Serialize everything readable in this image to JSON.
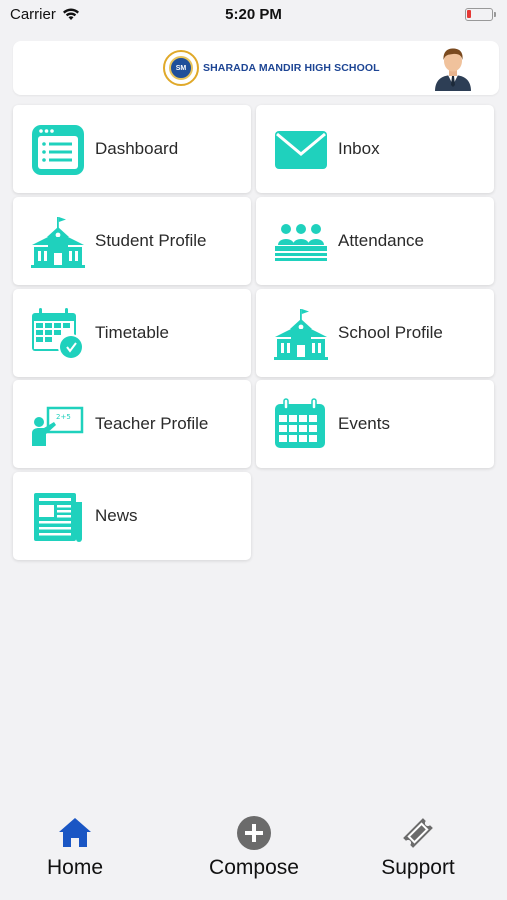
{
  "status_bar": {
    "carrier": "Carrier",
    "time": "5:20 PM",
    "wifi_icon": "wifi-icon",
    "battery_icon": "battery-low-icon",
    "battery_color": "#e53935"
  },
  "header": {
    "school_name": "SHARADA MANDIR HIGH SCHOOL",
    "logo_monogram": "SM",
    "logo_icon": "school-seal-logo",
    "avatar_icon": "user-avatar-icon"
  },
  "accent_color": "#1fd1bd",
  "menu": [
    {
      "label": "Dashboard",
      "icon": "dashboard-icon"
    },
    {
      "label": "Inbox",
      "icon": "envelope-icon"
    },
    {
      "label": "Student Profile",
      "icon": "school-building-icon"
    },
    {
      "label": "Attendance",
      "icon": "group-people-icon"
    },
    {
      "label": "Timetable",
      "icon": "calendar-clock-icon"
    },
    {
      "label": "School Profile",
      "icon": "school-building-icon"
    },
    {
      "label": "Teacher Profile",
      "icon": "teacher-board-icon"
    },
    {
      "label": "Events",
      "icon": "calendar-icon"
    },
    {
      "label": "News",
      "icon": "newspaper-icon"
    }
  ],
  "tabbar": {
    "home": {
      "label": "Home",
      "icon": "home-icon",
      "color": "#1a56c4",
      "active": true
    },
    "compose": {
      "label": "Compose",
      "icon": "plus-circle-icon",
      "color": "#6b6b6b"
    },
    "support": {
      "label": "Support",
      "icon": "ticket-icon",
      "color": "#6b6b6b"
    }
  }
}
